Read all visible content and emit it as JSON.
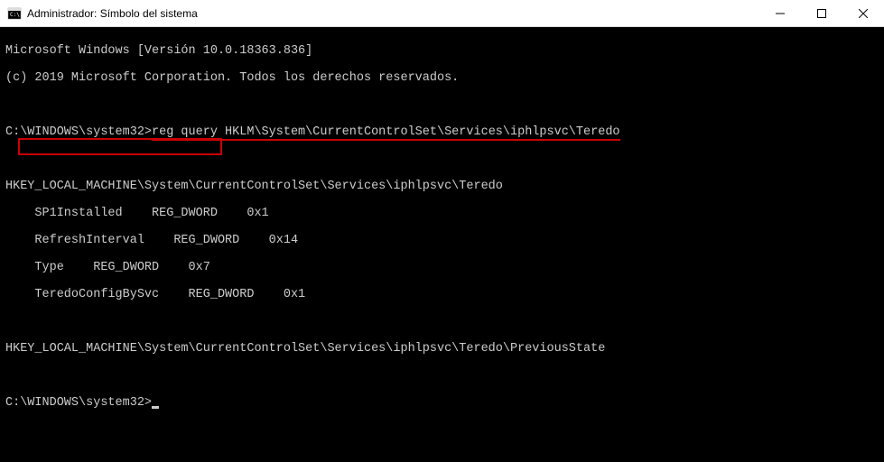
{
  "window": {
    "title": "Administrador: Símbolo del sistema"
  },
  "terminal": {
    "banner_line1": "Microsoft Windows [Versión 10.0.18363.836]",
    "banner_line2": "(c) 2019 Microsoft Corporation. Todos los derechos reservados.",
    "prompt1_path": "C:\\WINDOWS\\system32>",
    "prompt1_command": "reg query HKLM\\System\\CurrentControlSet\\Services\\iphlpsvc\\Teredo",
    "result_key": "HKEY_LOCAL_MACHINE\\System\\CurrentControlSet\\Services\\iphlpsvc\\Teredo",
    "values": [
      {
        "name": "SP1Installed",
        "type": "REG_DWORD",
        "data": "0x1"
      },
      {
        "name": "RefreshInterval",
        "type": "REG_DWORD",
        "data": "0x14"
      },
      {
        "name": "Type",
        "type": "REG_DWORD",
        "data": "0x7"
      },
      {
        "name": "TeredoConfigBySvc",
        "type": "REG_DWORD",
        "data": "0x1"
      }
    ],
    "row_sp1": "    SP1Installed    REG_DWORD    0x1",
    "row_refresh": "    RefreshInterval    REG_DWORD    0x14",
    "row_type": "    Type    REG_DWORD    0x7",
    "row_teredo": "    TeredoConfigBySvc    REG_DWORD    0x1",
    "result_subkey": "HKEY_LOCAL_MACHINE\\System\\CurrentControlSet\\Services\\iphlpsvc\\Teredo\\PreviousState",
    "prompt2_path": "C:\\WINDOWS\\system32>"
  }
}
